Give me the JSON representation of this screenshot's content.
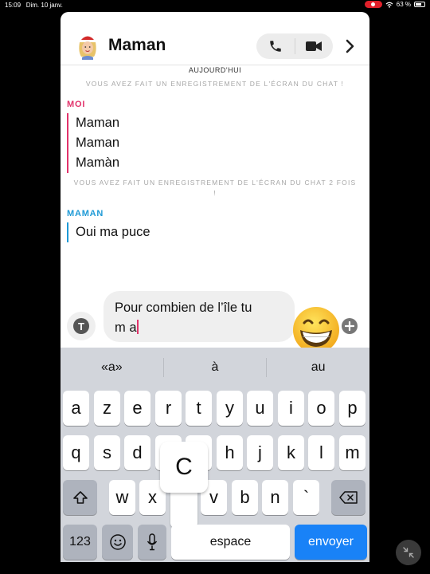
{
  "status_bar": {
    "time": "15:09",
    "date": "Dim. 10 janv.",
    "battery": "63 %"
  },
  "chat": {
    "name": "Maman",
    "day_label": "AUJOURD'HUI",
    "notice_1": "VOUS AVEZ FAIT UN ENREGISTREMENT DE L'ÉCRAN DU CHAT !",
    "notice_2": "VOUS AVEZ FAIT UN ENREGISTREMENT DE L'ÉCRAN DU CHAT 2 FOIS !",
    "groups": [
      {
        "sender": "MOI",
        "messages": [
          "Maman",
          "Maman",
          "Mamàn"
        ]
      },
      {
        "sender": "MAMAN",
        "messages": [
          "Oui ma puce"
        ]
      }
    ]
  },
  "composer": {
    "line1": "Pour combien de l’île tu",
    "line2": "m a"
  },
  "keyboard": {
    "suggestions": [
      "«a»",
      "à",
      "au"
    ],
    "row1": [
      "a",
      "z",
      "e",
      "r",
      "t",
      "y",
      "u",
      "i",
      "o",
      "p"
    ],
    "row2": [
      "q",
      "s",
      "d",
      "f",
      "g",
      "h",
      "j",
      "k",
      "l",
      "m"
    ],
    "row3": [
      "w",
      "x",
      "c",
      "v",
      "b",
      "n",
      "`"
    ],
    "pressed_key": "C",
    "numbers_label": "123",
    "space_label": "espace",
    "send_label": "envoyer"
  },
  "colors": {
    "me": "#e2336b",
    "them": "#1e9ad6",
    "send": "#1982f7"
  },
  "icons": [
    "phone-icon",
    "video-camera-icon",
    "chevron-right-icon",
    "text-tool-icon",
    "grinning-emoji",
    "plus-icon",
    "shift-icon",
    "backspace-icon",
    "emoji-keyboard-icon",
    "microphone-icon",
    "shrink-icon"
  ]
}
